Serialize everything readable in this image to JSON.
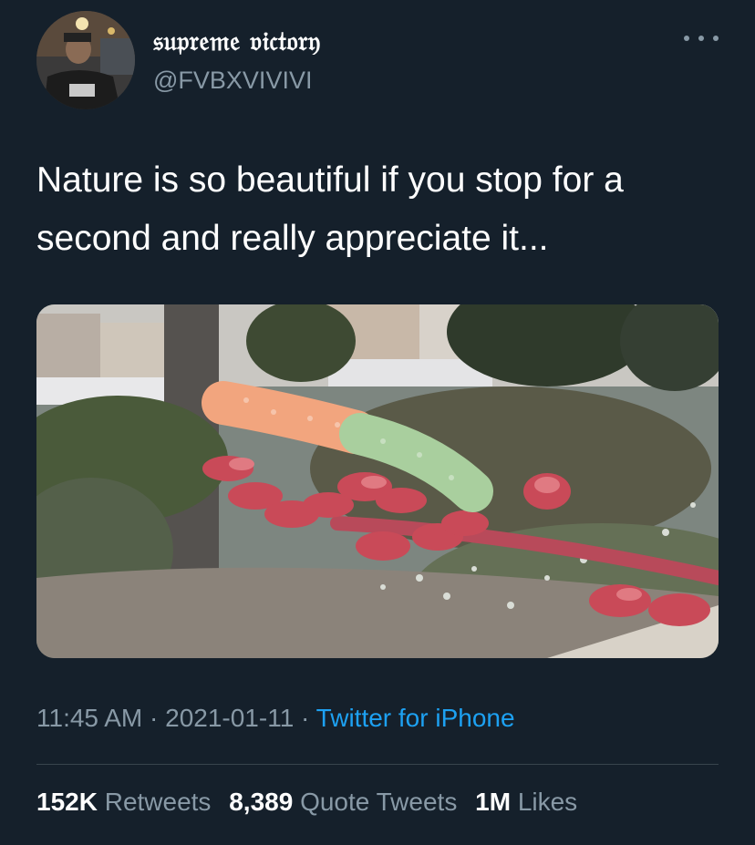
{
  "user": {
    "display_name": "𝔰𝔲𝔭𝔯𝔢𝔪𝔢 𝔳𝔦𝔠𝔱𝔬𝔯𝔶",
    "handle": "@FVBXVIVIVI"
  },
  "tweet": {
    "text": "Nature is so beautiful if you stop for a second and really appreciate it..."
  },
  "meta": {
    "time": "11:45 AM",
    "sep1": " · ",
    "date": "2021-01-11",
    "sep2": " · ",
    "source": "Twitter for iPhone"
  },
  "stats": {
    "retweets_count": "152K",
    "retweets_label": "Retweets",
    "quotes_count": "8,389",
    "quotes_label": "Quote Tweets",
    "likes_count": "1M",
    "likes_label": "Likes"
  },
  "icons": {
    "more": "more-horizontal-icon"
  },
  "colors": {
    "background": "#15202b",
    "primary_text": "#ffffff",
    "secondary_text": "#8899a6",
    "link": "#1da1f2",
    "divider": "#38444d"
  }
}
